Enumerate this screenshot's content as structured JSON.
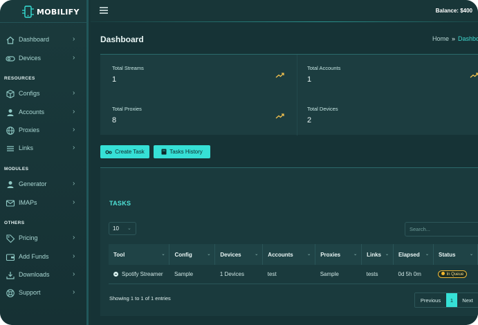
{
  "brand": {
    "name": "MOBILIFY"
  },
  "topbar": {
    "balance": "Balance: $400"
  },
  "sidebar": {
    "items_top": [
      {
        "label": "Dashboard",
        "icon": "home-icon"
      },
      {
        "label": "Devices",
        "icon": "toggle-icon"
      }
    ],
    "section_resources": "RESOURCES",
    "items_resources": [
      {
        "label": "Configs",
        "icon": "cube-icon"
      },
      {
        "label": "Accounts",
        "icon": "user-icon"
      },
      {
        "label": "Proxies",
        "icon": "globe-icon"
      },
      {
        "label": "Links",
        "icon": "list-icon"
      }
    ],
    "section_modules": "MODULES",
    "items_modules": [
      {
        "label": "Generator",
        "icon": "user-icon"
      },
      {
        "label": "IMAPs",
        "icon": "mail-icon"
      }
    ],
    "section_others": "OTHERS",
    "items_others": [
      {
        "label": "Pricing",
        "icon": "tag-icon"
      },
      {
        "label": "Add Funds",
        "icon": "wallet-icon"
      },
      {
        "label": "Downloads",
        "icon": "download-icon"
      },
      {
        "label": "Support",
        "icon": "lifebuoy-icon"
      }
    ]
  },
  "page": {
    "title": "Dashboard",
    "breadcrumb": {
      "home": "Home",
      "sep": "»",
      "current": "Dashboard"
    }
  },
  "stats": [
    {
      "label": "Total Streams",
      "value": "1"
    },
    {
      "label": "Total Accounts",
      "value": "1"
    },
    {
      "label": "Total Proxies",
      "value": "8"
    },
    {
      "label": "Total Devices",
      "value": "2"
    }
  ],
  "buttons": {
    "create_task": "Create Task",
    "tasks_history": "Tasks History"
  },
  "tasks": {
    "title": "TASKS",
    "page_size": "10",
    "search_placeholder": "Search...",
    "columns": [
      "Tool",
      "Config",
      "Devices",
      "Accounts",
      "Proxies",
      "Links",
      "Elapsed",
      "Status"
    ],
    "rows": [
      {
        "tool": "Spotify Streamer",
        "config": "Sample",
        "devices": "1 Devices",
        "accounts": "test",
        "proxies": "Sample",
        "links": "tests",
        "elapsed": "0d 5h 0m",
        "status": "In Queue"
      }
    ],
    "showing": "Showing 1 to 1 of 1 entries",
    "pagination": {
      "prev": "Previous",
      "page": "1",
      "next": "Next"
    }
  },
  "colors": {
    "accent": "#36e0d6",
    "bg": "#173436",
    "status_queue": "#f0b93a"
  }
}
